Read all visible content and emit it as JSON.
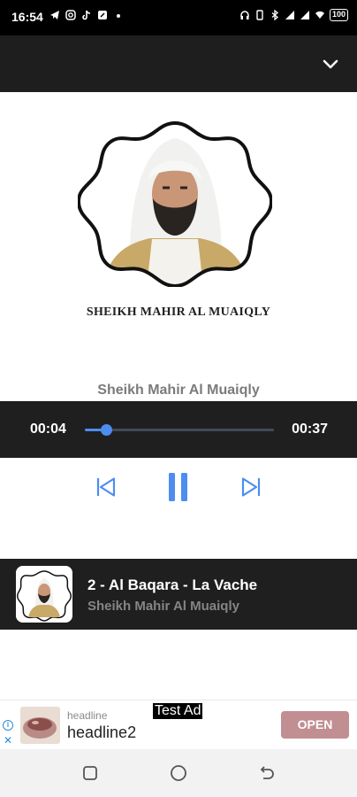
{
  "status_bar": {
    "time": "16:54",
    "left_icons": [
      "telegram-icon",
      "instagram-icon",
      "tiktok-icon",
      "app-icon",
      "dot-icon"
    ],
    "right_icons": [
      "headphones-icon",
      "vibrate-icon",
      "bluetooth-icon",
      "signal-icon",
      "signal-icon",
      "wifi-icon"
    ],
    "battery": "100"
  },
  "top_bar": {
    "icon": "chevron-down-icon"
  },
  "artwork": {
    "caption": "SHEIKH MAHIR AL MUAIQLY"
  },
  "player": {
    "artist": "Sheikh Mahir Al Muaiqly",
    "current_time": "00:04",
    "total_time": "00:37",
    "progress": 0.11,
    "accent_color": "#4d8df0",
    "controls": {
      "prev_icon": "skip-previous-icon",
      "play_icon": "pause-icon",
      "next_icon": "skip-next-icon"
    }
  },
  "now_playing": {
    "title": "2 - Al Baqara - La Vache",
    "artist": "Sheikh Mahir Al Muaiqly"
  },
  "ad": {
    "headline_small": "headline",
    "headline": "headline2",
    "tag": "Test Ad",
    "cta": "OPEN",
    "cta_color": "#c18e92"
  },
  "nav_bar": {
    "icons": [
      "recents-icon",
      "home-icon",
      "back-icon"
    ]
  }
}
